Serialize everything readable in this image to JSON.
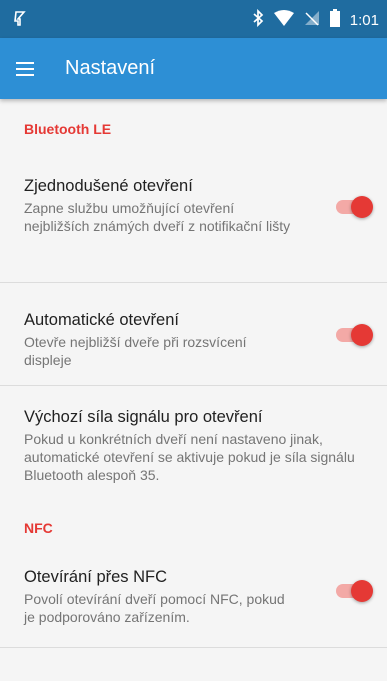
{
  "status_bar": {
    "time": "1:01",
    "icons": [
      "signal-icon",
      "bluetooth-icon",
      "wifi-icon",
      "no-sim-icon",
      "battery-icon"
    ]
  },
  "toolbar": {
    "title": "Nastavení",
    "menu_icon": "hamburger-menu-icon"
  },
  "sections": {
    "ble": {
      "header": "Bluetooth LE"
    },
    "nfc": {
      "header": "NFC"
    }
  },
  "prefs": {
    "simple_open": {
      "title": "Zjednodušené otevření",
      "summary": "Zapne službu umožňující otevření nejbližších známých dveří z notifikační lišty",
      "enabled": true
    },
    "auto_open": {
      "title": "Automatické otevření",
      "summary": "Otevře nejbližší dveře při rozsvícení displeje",
      "enabled": true
    },
    "signal_strength": {
      "title": "Výchozí síla signálu pro otevření",
      "summary": "Pokud u konkrétních dveří není nastaveno jinak, automatické otevření se aktivuje pokud je síla signálu Bluetooth alespoň 35."
    },
    "nfc_open": {
      "title": "Otevírání přes NFC",
      "summary": "Povolí otevírání dveří pomocí NFC, pokud je podporováno zařízením.",
      "enabled": true
    }
  },
  "colors": {
    "status_bar": "#1f6ca0",
    "toolbar": "#2d8fd5",
    "accent": "#e53935",
    "switch_track": "#f3a9a6"
  }
}
